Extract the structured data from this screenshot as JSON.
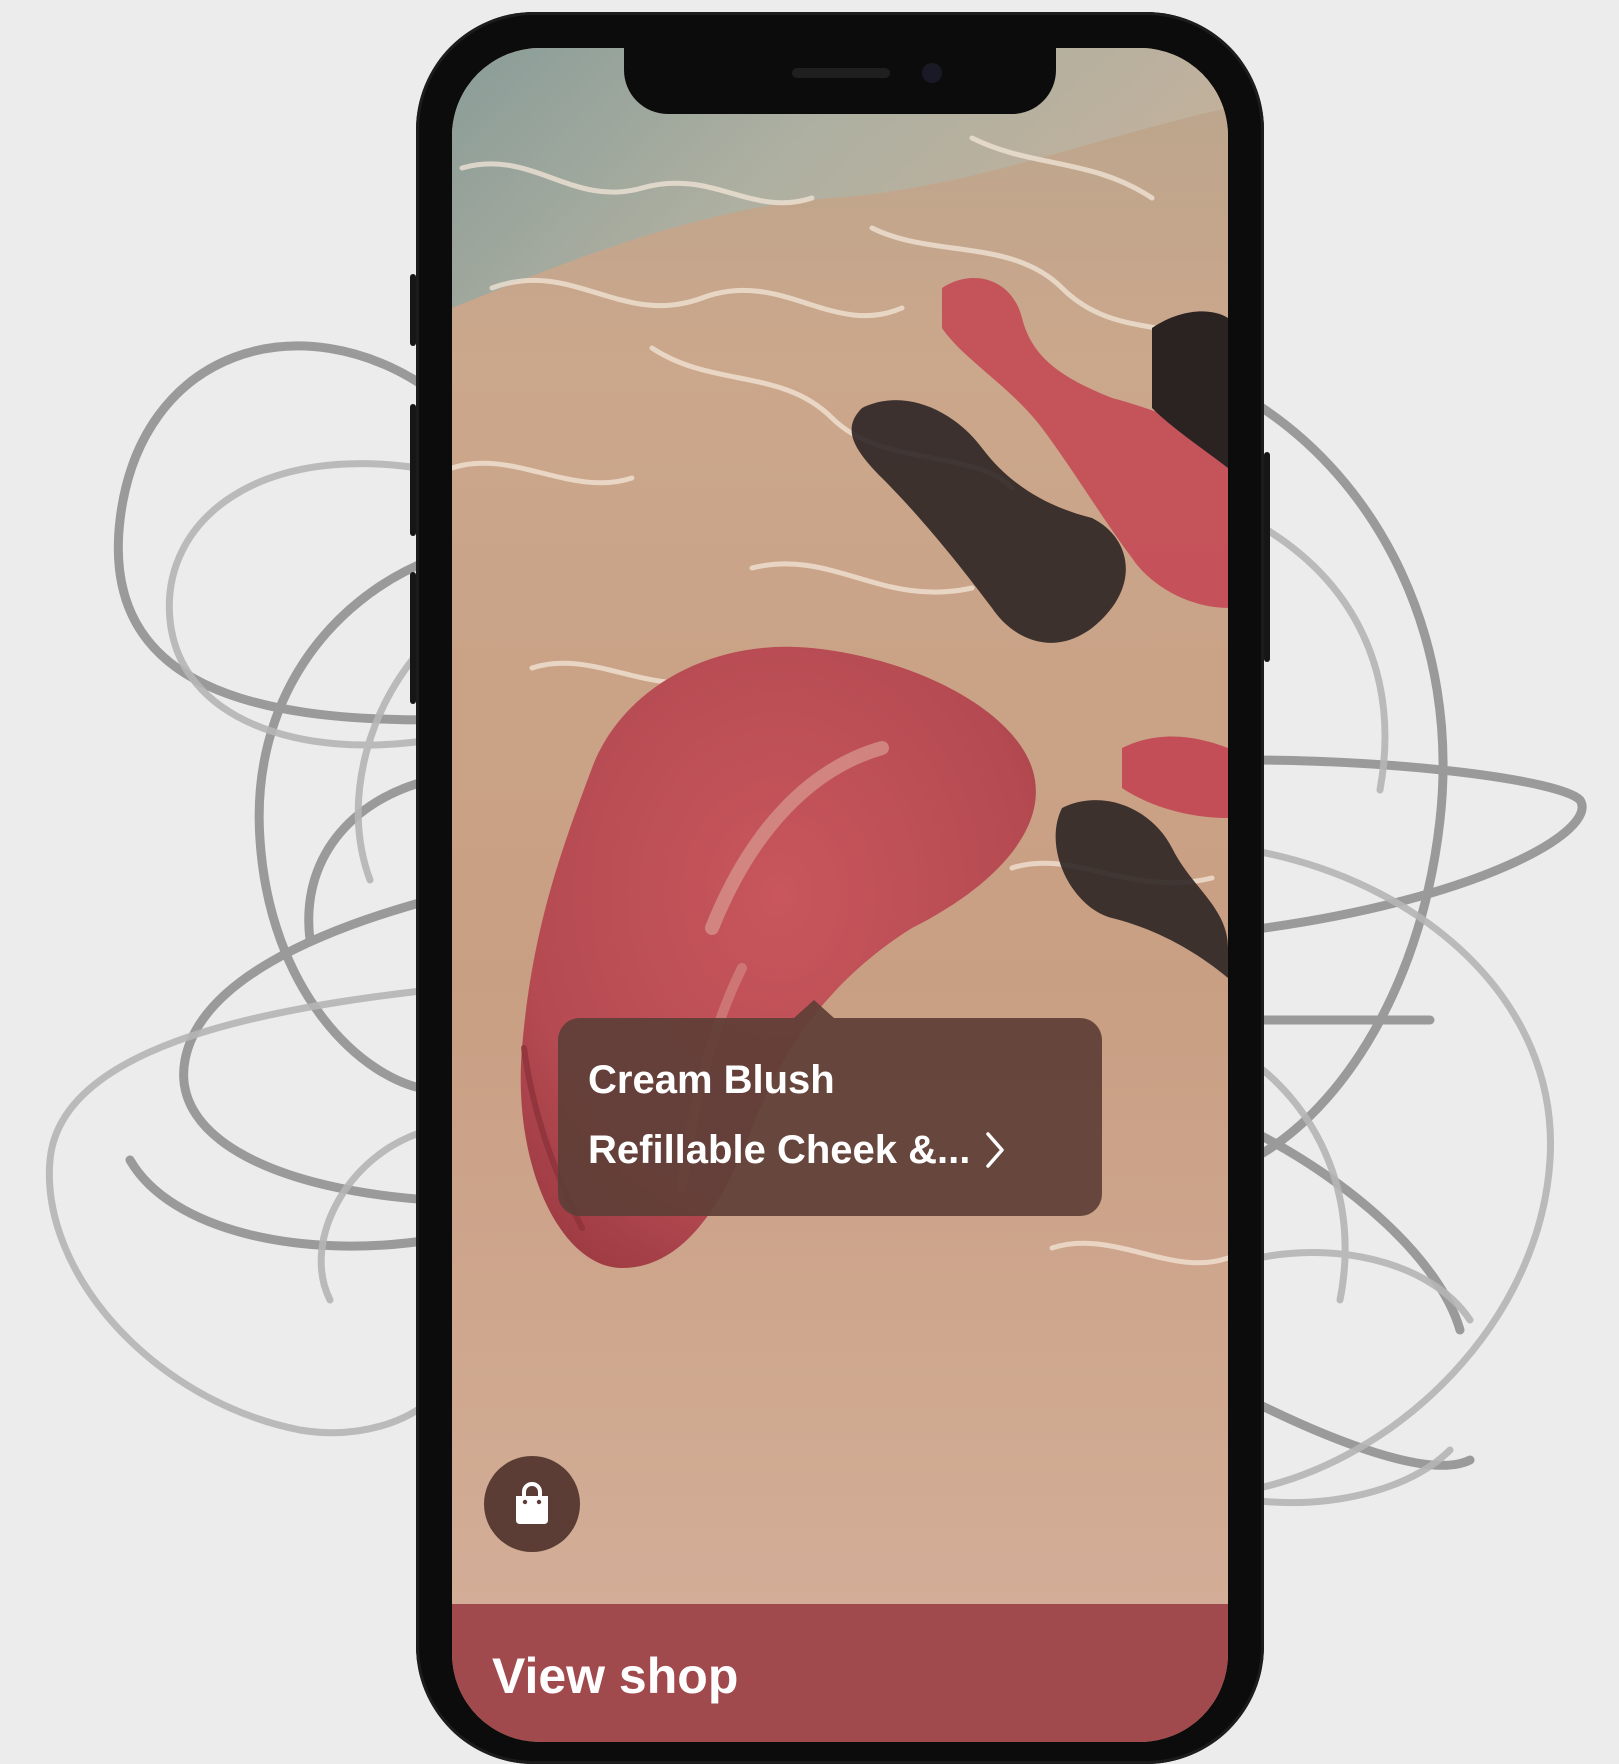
{
  "product_tag": {
    "title": "Cream Blush",
    "subtitle": "Refillable Cheek &...",
    "chevron_icon": "chevron-right-icon"
  },
  "shop_button_icon": "shopping-bag-icon",
  "view_shop": {
    "label": "View shop"
  },
  "colors": {
    "background": "#ececec",
    "phone_frame": "#0c0c0c",
    "tag_background": "#5f3e37",
    "bag_button": "#5b3d36",
    "shop_bar": "#a14a4e",
    "blush": "#b84b52",
    "sand": "#c9a287"
  }
}
